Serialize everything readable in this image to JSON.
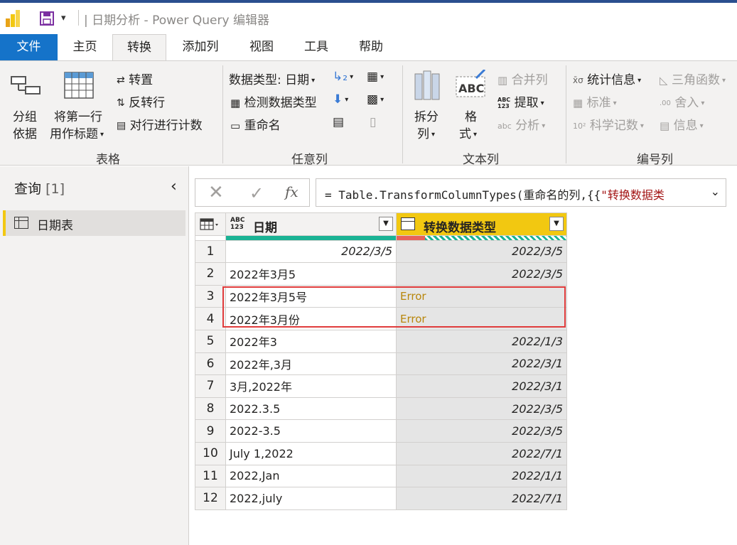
{
  "window": {
    "title": "| 日期分析 - Power Query 编辑器"
  },
  "tabs": [
    {
      "label": "文件"
    },
    {
      "label": "主页"
    },
    {
      "label": "转换"
    },
    {
      "label": "添加列"
    },
    {
      "label": "视图"
    },
    {
      "label": "工具"
    },
    {
      "label": "帮助"
    }
  ],
  "ribbon": {
    "group_by_line1": "分组",
    "group_by_line2": "依据",
    "first_row_line1": "将第一行",
    "first_row_line2": "用作标题",
    "transpose": "转置",
    "reverse_rows": "反转行",
    "count_rows": "对行进行计数",
    "table_group": "表格",
    "data_type": "数据类型: 日期",
    "detect_type": "检测数据类型",
    "rename": "重命名",
    "any_column_group": "任意列",
    "split_line1": "拆分",
    "split_line2": "列",
    "format_line1": "格",
    "format_line2": "式",
    "merge_columns": "合并列",
    "extract": "提取",
    "parse": "分析",
    "text_column_group": "文本列",
    "statistics": "统计信息",
    "standard": "标准",
    "scientific": "科学记数",
    "trig": "三角函数",
    "rounding": "舍入",
    "information": "信息",
    "number_column_group": "编号列"
  },
  "queries": {
    "title": "查询",
    "count": "[1]",
    "items": [
      {
        "label": "日期表"
      }
    ]
  },
  "formula_bar": {
    "prefix": "= Table.TransformColumnTypes(重命名的列,{{",
    "string_part": "\"转换数据类"
  },
  "grid": {
    "columns": [
      {
        "type_top": "ABC",
        "type_bottom": "123",
        "label": "日期"
      },
      {
        "label": "转换数据类型"
      }
    ],
    "rows": [
      {
        "n": "1",
        "c1": "2022/3/5",
        "c2": "2022/3/5"
      },
      {
        "n": "2",
        "c1": "2022年3月5",
        "c2": "2022/3/5"
      },
      {
        "n": "3",
        "c1": "2022年3月5号",
        "c2": "Error"
      },
      {
        "n": "4",
        "c1": "2022年3月份",
        "c2": "Error"
      },
      {
        "n": "5",
        "c1": "2022年3",
        "c2": "2022/1/3"
      },
      {
        "n": "6",
        "c1": "2022年,3月",
        "c2": "2022/3/1"
      },
      {
        "n": "7",
        "c1": "3月,2022年",
        "c2": "2022/3/1"
      },
      {
        "n": "8",
        "c1": "2022.3.5",
        "c2": "2022/3/5"
      },
      {
        "n": "9",
        "c1": "2022-3.5",
        "c2": "2022/3/5"
      },
      {
        "n": "10",
        "c1": "July 1,2022",
        "c2": "2022/7/1"
      },
      {
        "n": "11",
        "c1": "2022,Jan",
        "c2": "2022/1/1"
      },
      {
        "n": "12",
        "c1": "2022,july",
        "c2": "2022/7/1"
      }
    ]
  },
  "colors": {
    "accent_file_tab": "#1573c9",
    "selected_column": "#f2c811",
    "error_text": "#b8860b",
    "highlight_box": "#e03c3c"
  }
}
